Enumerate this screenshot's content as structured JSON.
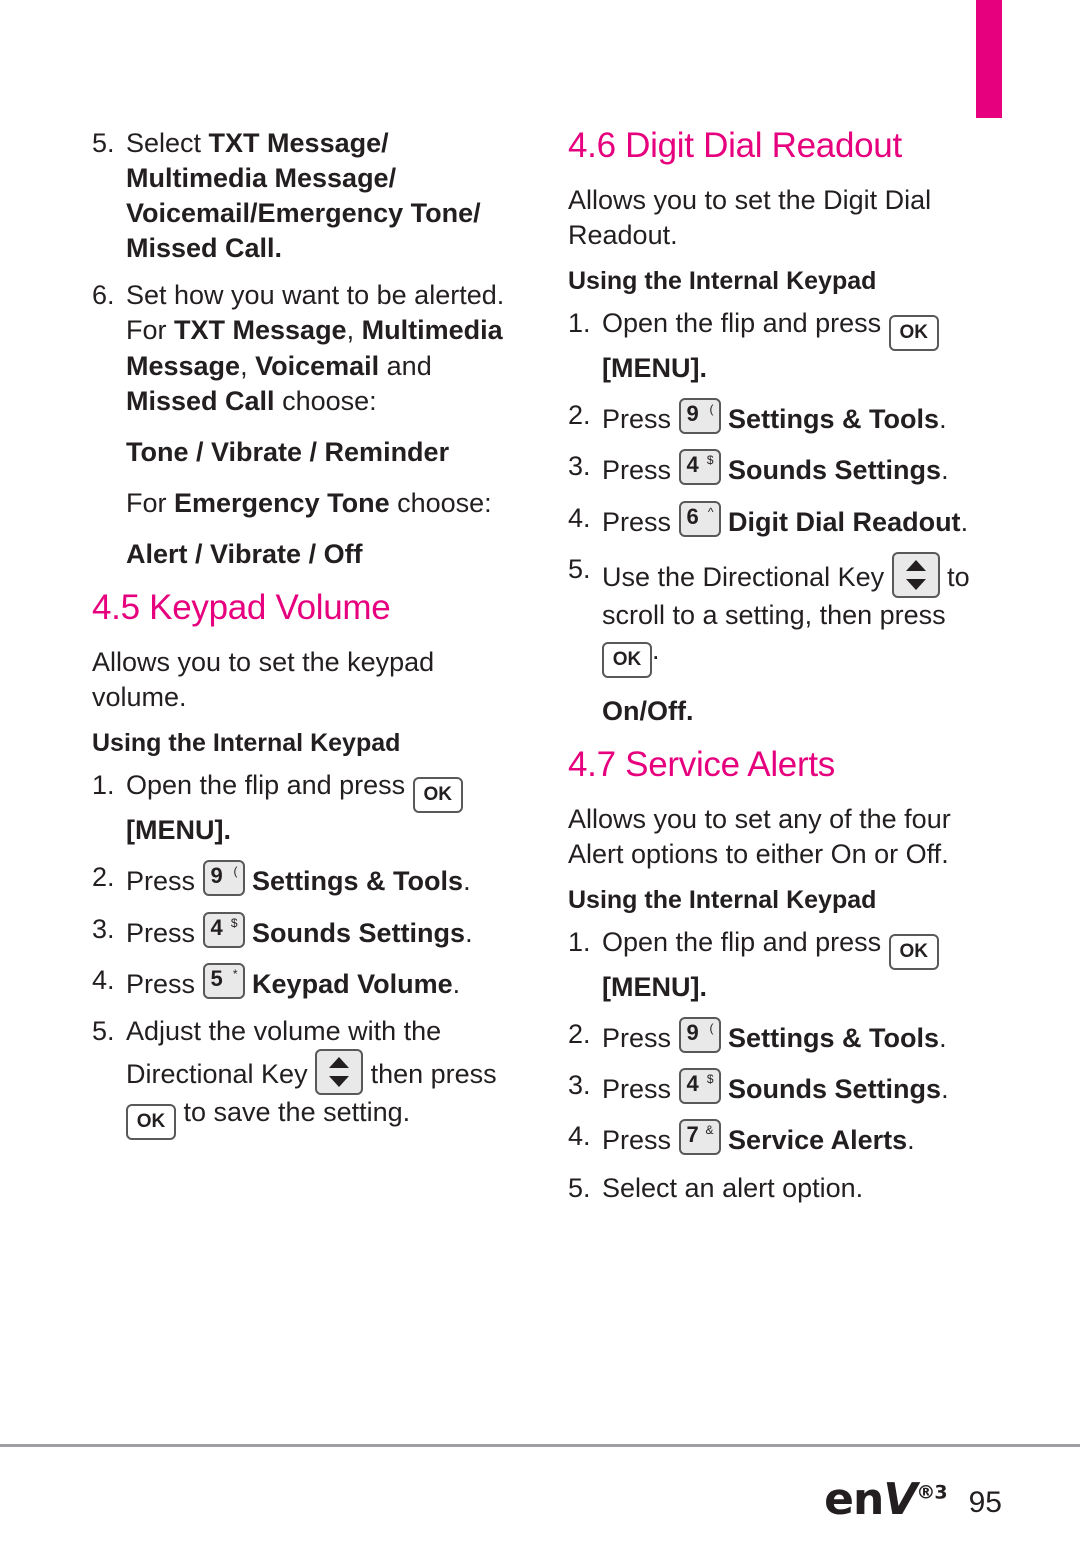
{
  "page": {
    "number": "95",
    "logo_text": "enV",
    "logo_sup": "®3"
  },
  "left_column": {
    "steps_continued": [
      {
        "num": "5.",
        "segments": [
          {
            "text": "Select ",
            "bold": false
          },
          {
            "text": "TXT Message/ Multimedia Message/ Voicemail/Emergency Tone/ Missed Call.",
            "bold": true
          }
        ]
      },
      {
        "num": "6.",
        "segments": [
          {
            "text": "Set how you want to be alerted. For ",
            "bold": false
          },
          {
            "text": "TXT Message",
            "bold": true
          },
          {
            "text": ", ",
            "bold": false
          },
          {
            "text": "Multimedia Message",
            "bold": true
          },
          {
            "text": ", ",
            "bold": false
          },
          {
            "text": "Voicemail",
            "bold": true
          },
          {
            "text": " and ",
            "bold": false
          },
          {
            "text": "Missed Call",
            "bold": true
          },
          {
            "text": " choose:",
            "bold": false
          }
        ]
      }
    ],
    "choice_1": "Tone / Vibrate / Reminder",
    "emergency_intro_pre": "For ",
    "emergency_intro_bold": "Emergency Tone",
    "emergency_intro_post": " choose:",
    "choice_2": "Alert / Vibrate / Off",
    "section": {
      "heading": "4.5 Keypad Volume",
      "intro": "Allows you to set the keypad volume.",
      "subheading": "Using the Internal Keypad",
      "steps": [
        {
          "num": "1.",
          "pre": "Open the flip and press ",
          "key": "OK",
          "post": "[MENU].",
          "post_bold": true
        },
        {
          "num": "2.",
          "pre": "Press ",
          "key_digit": "9",
          "key_sup": "(",
          "label": "Settings & Tools",
          "tail": "."
        },
        {
          "num": "3.",
          "pre": "Press ",
          "key_digit": "4",
          "key_sup": "$",
          "label": "Sounds Settings",
          "tail": "."
        },
        {
          "num": "4.",
          "pre": "Press ",
          "key_digit": "5",
          "key_sup": "*",
          "label": "Keypad Volume",
          "tail": "."
        },
        {
          "num": "5.",
          "pre": "Adjust the volume with the Directional Key ",
          "mid": " then press ",
          "post": " to save the setting."
        }
      ]
    }
  },
  "right_column": {
    "section_digit_dial": {
      "heading": "4.6 Digit Dial Readout",
      "intro": "Allows you to set the Digit Dial Readout.",
      "subheading": "Using the Internal Keypad",
      "steps": [
        {
          "num": "1.",
          "pre": "Open the flip and press ",
          "key": "OK",
          "post": "[MENU]."
        },
        {
          "num": "2.",
          "pre": "Press ",
          "key_digit": "9",
          "key_sup": "(",
          "label": "Settings & Tools",
          "tail": "."
        },
        {
          "num": "3.",
          "pre": "Press ",
          "key_digit": "4",
          "key_sup": "$",
          "label": "Sounds Settings",
          "tail": "."
        },
        {
          "num": "4.",
          "pre": "Press ",
          "key_digit": "6",
          "key_sup": "^",
          "label": "Digit Dial Readout",
          "tail": "."
        },
        {
          "num": "5.",
          "pre": "Use the Directional Key ",
          "mid": " to scroll to a setting, then press ",
          "post": "."
        }
      ],
      "options": "On/Off."
    },
    "section_service_alerts": {
      "heading": "4.7 Service Alerts",
      "intro": "Allows you to set any of the four Alert options to either On or Off.",
      "subheading": "Using the Internal Keypad",
      "steps": [
        {
          "num": "1.",
          "pre": "Open the flip and press ",
          "key": "OK",
          "post": "[MENU]."
        },
        {
          "num": "2.",
          "pre": "Press ",
          "key_digit": "9",
          "key_sup": "(",
          "label": "Settings & Tools",
          "tail": "."
        },
        {
          "num": "3.",
          "pre": "Press ",
          "key_digit": "4",
          "key_sup": "$",
          "label": "Sounds Settings",
          "tail": "."
        },
        {
          "num": "4.",
          "pre": "Press ",
          "key_digit": "7",
          "key_sup": "&",
          "label": "Service Alerts",
          "tail": "."
        },
        {
          "num": "5.",
          "text": "Select an alert option."
        }
      ]
    }
  },
  "colors": {
    "accent": "#e6007e",
    "text": "#231f20",
    "rule": "#9d9fa2",
    "key_fill": "#e9e9ea",
    "key_border": "#58595b"
  }
}
